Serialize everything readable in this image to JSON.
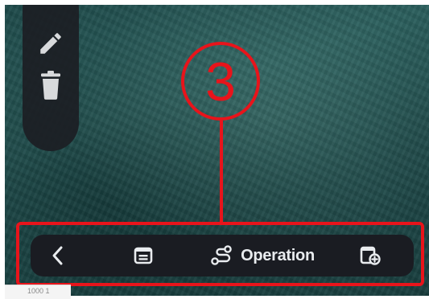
{
  "annotation": {
    "step_number": "3",
    "color": "#e8141b"
  },
  "tool_rail": {
    "items": [
      {
        "icon": "pencil-icon",
        "label": "Edit"
      },
      {
        "icon": "trash-icon",
        "label": "Delete"
      }
    ]
  },
  "bottom_toolbar": {
    "back_icon": "chevron-left-icon",
    "card_icon": "card-icon",
    "operation_icon": "route-icon",
    "operation_label": "Operation",
    "add_icon": "add-document-icon"
  },
  "corner_label": {
    "text": "1000 1"
  },
  "colors": {
    "background": "#1e4a4a",
    "toolbar": "#1a1c22",
    "icon": "#e9ecef",
    "rail_icon": "#d8dadc"
  }
}
